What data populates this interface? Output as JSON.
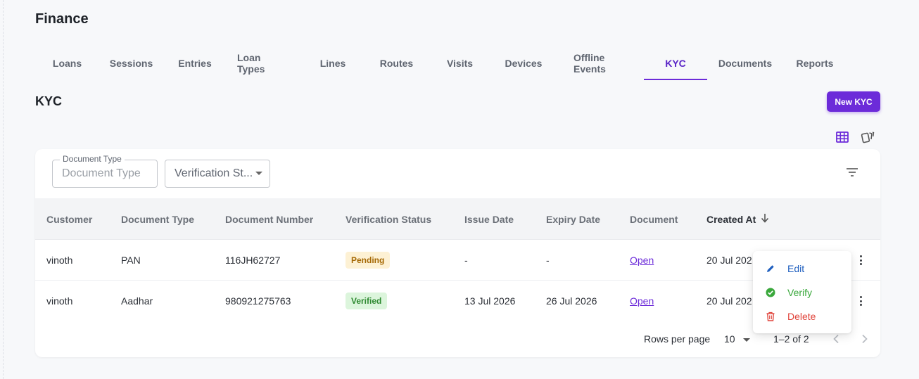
{
  "page": {
    "title": "Finance"
  },
  "tabs": [
    {
      "label": "Loans"
    },
    {
      "label": "Sessions"
    },
    {
      "label": "Entries"
    },
    {
      "label": "Loan Types"
    },
    {
      "label": "Lines"
    },
    {
      "label": "Routes"
    },
    {
      "label": "Visits"
    },
    {
      "label": "Devices"
    },
    {
      "label": "Offline Events"
    },
    {
      "label": "KYC"
    },
    {
      "label": "Documents"
    },
    {
      "label": "Reports"
    }
  ],
  "active_tab": "KYC",
  "section": {
    "title": "KYC",
    "new_button": "New KYC"
  },
  "view_toggle": {
    "table_icon": "grid-table-icon",
    "card_icon": "cards-icon",
    "active": "table"
  },
  "filters": {
    "document_type": {
      "label": "Document Type",
      "placeholder": "Document Type"
    },
    "verification_status": {
      "placeholder": "Verification St..."
    },
    "filter_icon": "filter-list-icon"
  },
  "table": {
    "columns": [
      "Customer",
      "Document Type",
      "Document Number",
      "Verification Status",
      "Issue Date",
      "Expiry Date",
      "Document",
      "Created At"
    ],
    "sorted_column": "Created At",
    "sort_direction": "desc",
    "rows": [
      {
        "customer": "vinoth",
        "document_type": "PAN",
        "document_number": "116JH62727",
        "status": "Pending",
        "issue_date": "-",
        "expiry_date": "-",
        "document": "Open",
        "created_at": "20 Jul 202"
      },
      {
        "customer": "vinoth",
        "document_type": "Aadhar",
        "document_number": "980921275763",
        "status": "Verified",
        "issue_date": "13 Jul 2026",
        "expiry_date": "26 Jul 2026",
        "document": "Open",
        "created_at": "20 Jul 202"
      }
    ]
  },
  "pagination": {
    "rows_per_page_label": "Rows per page",
    "rows_per_page": "10",
    "range": "1–2 of 2"
  },
  "row_menu": {
    "items": [
      {
        "label": "Edit",
        "icon": "pencil-icon",
        "color": "#1f5fbf"
      },
      {
        "label": "Verify",
        "icon": "check-circle-icon",
        "color": "#3aa83c"
      },
      {
        "label": "Delete",
        "icon": "trash-icon",
        "color": "#e0443b"
      }
    ]
  },
  "colors": {
    "accent": "#6c2bd9",
    "pending": "#a66a06",
    "verified": "#2f8a31",
    "danger": "#e0443b"
  }
}
